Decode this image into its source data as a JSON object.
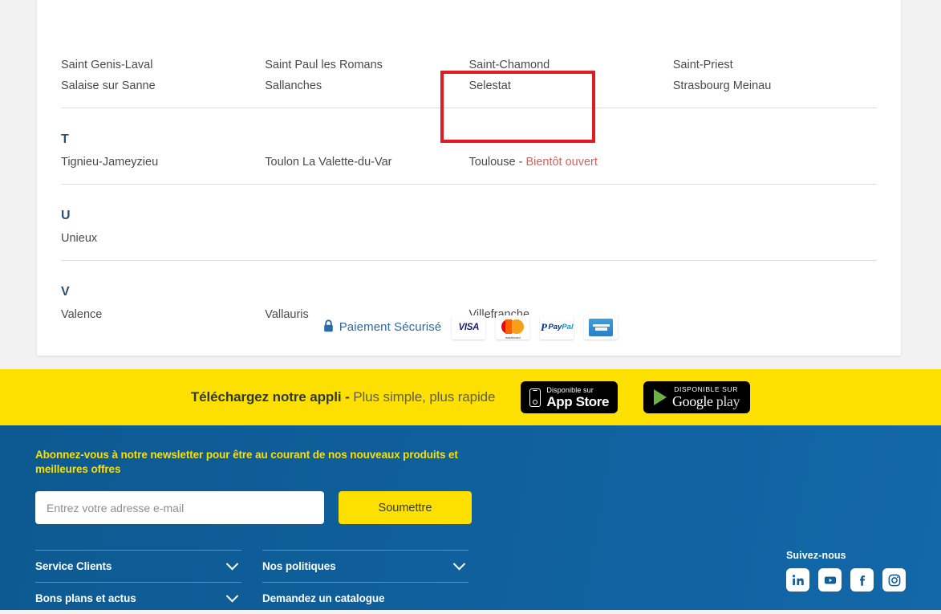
{
  "store_locator": {
    "groups": [
      {
        "letter": "",
        "columns": [
          [
            "Saint Genis-Laval",
            "Salaise sur Sanne"
          ],
          [
            "Saint Paul les Romans",
            "Sallanches"
          ],
          [
            "Saint-Chamond",
            "Selestat"
          ],
          [
            "Saint-Priest",
            "Strasbourg Meinau"
          ]
        ]
      },
      {
        "letter": "T",
        "columns": [
          [
            "Tignieu-Jameyzieu"
          ],
          [
            "Toulon La Valette-du-Var"
          ],
          [
            "Toulouse - Bientôt ouvert"
          ],
          []
        ]
      },
      {
        "letter": "U",
        "columns": [
          [
            "Unieux"
          ],
          [],
          [],
          []
        ]
      },
      {
        "letter": "V",
        "columns": [
          [
            "Valence"
          ],
          [
            "Vallauris"
          ],
          [
            "Villefranche"
          ],
          []
        ]
      }
    ],
    "highlight": {
      "city": "Toulouse",
      "separator": " - ",
      "status": "Bientôt ouvert",
      "status_color": "#d0635f",
      "box_color": "#e01b22"
    }
  },
  "secure_payment": {
    "label": "Paiement Sécurisé",
    "lock_icon": "lock-icon",
    "text_color": "#2c6aa8",
    "methods": [
      {
        "name": "visa",
        "label": "VISA"
      },
      {
        "name": "mastercard",
        "label": "mastercard"
      },
      {
        "name": "paypal",
        "label": "PayPal"
      },
      {
        "name": "american-express",
        "label": "AMERICAN EXPRESS"
      }
    ]
  },
  "app_banner": {
    "background": "#fddf00",
    "headline_bold": "Téléchargez notre appli - ",
    "headline_rest": "Plus simple, plus rapide",
    "app_store": {
      "small": "Disponible sur",
      "big": "App Store",
      "icon": "apple-phone-icon"
    },
    "google_play": {
      "small": "DISPONIBLE SUR",
      "big": "Google",
      "big_light": " play",
      "icon": "google-play-triangle-icon"
    }
  },
  "footer": {
    "background": "#0f5f9b",
    "newsletter": {
      "heading": "Abonnez-vous à notre newsletter pour être au courant de nos nouveaux produits et meilleures offres",
      "heading_color": "#fddf00",
      "input_value": "",
      "input_placeholder": "Entrez votre adresse e-mail",
      "submit_label": "Soumettre",
      "submit_color": "#fddf00"
    },
    "accordions": {
      "col1": [
        {
          "label": "Service Clients",
          "chevron": true
        },
        {
          "label": "Bons plans et actus",
          "chevron": true
        }
      ],
      "col2": [
        {
          "label": "Nos politiques",
          "chevron": true
        },
        {
          "label": "Demandez un catalogue",
          "chevron": false
        }
      ]
    },
    "social": {
      "title": "Suivez-nous",
      "icons": [
        {
          "name": "linkedin-icon",
          "label": "LinkedIn"
        },
        {
          "name": "youtube-icon",
          "label": "YouTube"
        },
        {
          "name": "facebook-icon",
          "label": "Facebook"
        },
        {
          "name": "instagram-icon",
          "label": "Instagram"
        }
      ]
    }
  }
}
